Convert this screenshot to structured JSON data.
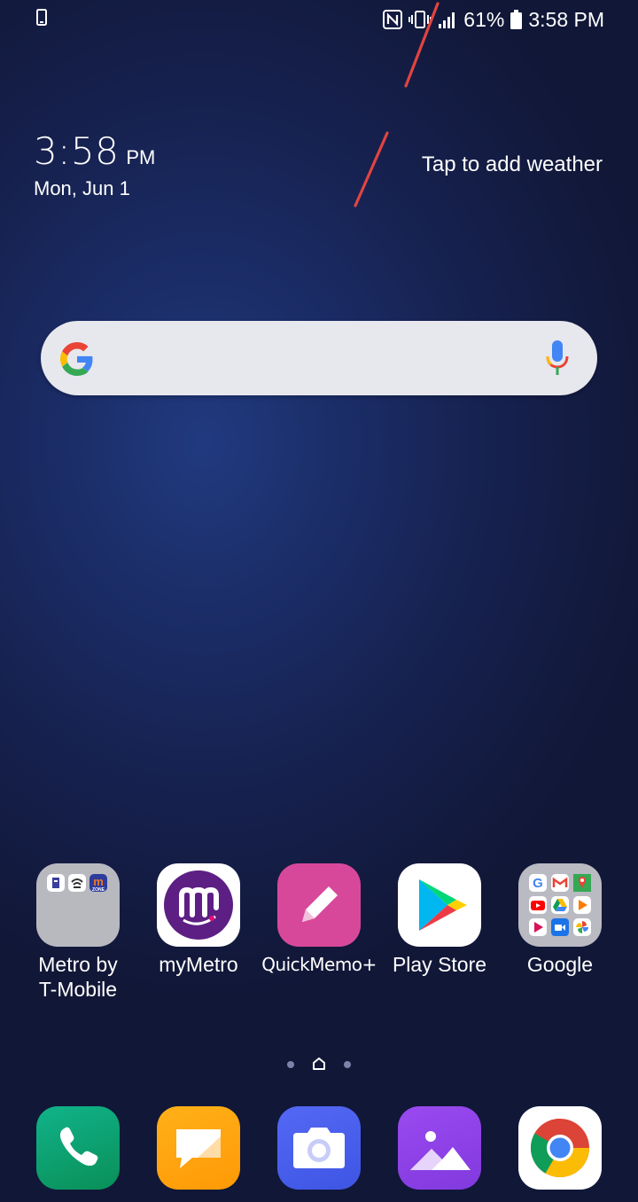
{
  "status_bar": {
    "battery_percent": "61%",
    "time": "3:58 PM",
    "icons": [
      "phone-outline-icon",
      "nfc-icon",
      "vibrate-icon",
      "signal-icon",
      "battery-icon"
    ]
  },
  "clock_widget": {
    "time": "3:58",
    "ampm": "PM",
    "date": "Mon, Jun 1"
  },
  "weather_widget": {
    "label": "Tap to add weather"
  },
  "search_bar": {
    "icons": [
      "google-g-icon",
      "mic-icon"
    ],
    "colors": {
      "background": "#e7e7ee",
      "google_blue": "#4285f4",
      "google_red": "#ea4335",
      "google_yellow": "#fbbc05",
      "google_green": "#34a853"
    }
  },
  "home_apps": [
    {
      "label": "Metro by T-Mobile",
      "icon": "metro-folder-icon"
    },
    {
      "label": "myMetro",
      "icon": "mymetro-icon"
    },
    {
      "label": "QuickMemo+",
      "icon": "quickmemo-icon"
    },
    {
      "label": "Play Store",
      "icon": "play-store-icon"
    },
    {
      "label": "Google",
      "icon": "google-folder-icon"
    }
  ],
  "page_indicator": {
    "pages": 3,
    "current": "home",
    "icons": [
      "page-dot",
      "home-icon",
      "page-dot"
    ]
  },
  "dock": [
    {
      "icon": "phone-icon",
      "color": "#0fa878"
    },
    {
      "icon": "messaging-icon",
      "color": "#ffa50f"
    },
    {
      "icon": "camera-icon",
      "color": "#4a5ff0"
    },
    {
      "icon": "gallery-icon",
      "color": "#8e42e8"
    },
    {
      "icon": "chrome-icon",
      "color": "#ffffff"
    }
  ]
}
